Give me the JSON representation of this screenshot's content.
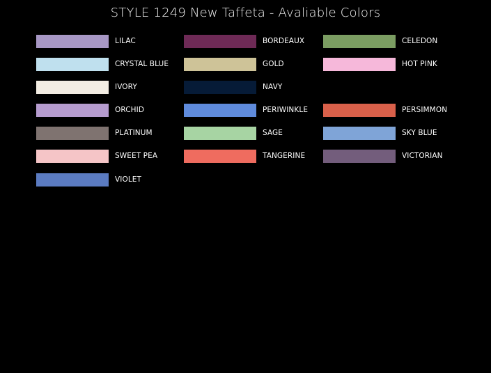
{
  "page": {
    "title": "STYLE 1249 New Taffeta - Avaliable Colors"
  },
  "columns": [
    {
      "swatches": [
        {
          "label": "LILAC",
          "color": "#a797c4"
        },
        {
          "label": "CRYSTAL BLUE",
          "color": "#bfe0ee"
        },
        {
          "label": "IVORY",
          "color": "#f3ede3"
        },
        {
          "label": "ORCHID",
          "color": "#b69ccf"
        },
        {
          "label": "PLATINUM",
          "color": "#7f7370"
        },
        {
          "label": "SWEET PEA",
          "color": "#f5c5c7"
        },
        {
          "label": "VIOLET",
          "color": "#5b7bc1"
        }
      ]
    },
    {
      "swatches": [
        {
          "label": "BORDEAUX",
          "color": "#6e2a56"
        },
        {
          "label": "GOLD",
          "color": "#cec398"
        },
        {
          "label": "NAVY",
          "color": "#061b37"
        },
        {
          "label": "PERIWINKLE",
          "color": "#5f8bdc"
        },
        {
          "label": "SAGE",
          "color": "#a7d4a3"
        },
        {
          "label": "TANGERINE",
          "color": "#ef6c5f"
        }
      ]
    },
    {
      "swatches": [
        {
          "label": "CELEDON",
          "color": "#7b9d62"
        },
        {
          "label": "HOT PINK",
          "color": "#f6b8da"
        },
        {
          "label": "",
          "color": ""
        },
        {
          "label": "PERSIMMON",
          "color": "#d9604a"
        },
        {
          "label": "SKY BLUE",
          "color": "#7fa4d7"
        },
        {
          "label": "VICTORIAN",
          "color": "#735d7c"
        }
      ]
    }
  ]
}
